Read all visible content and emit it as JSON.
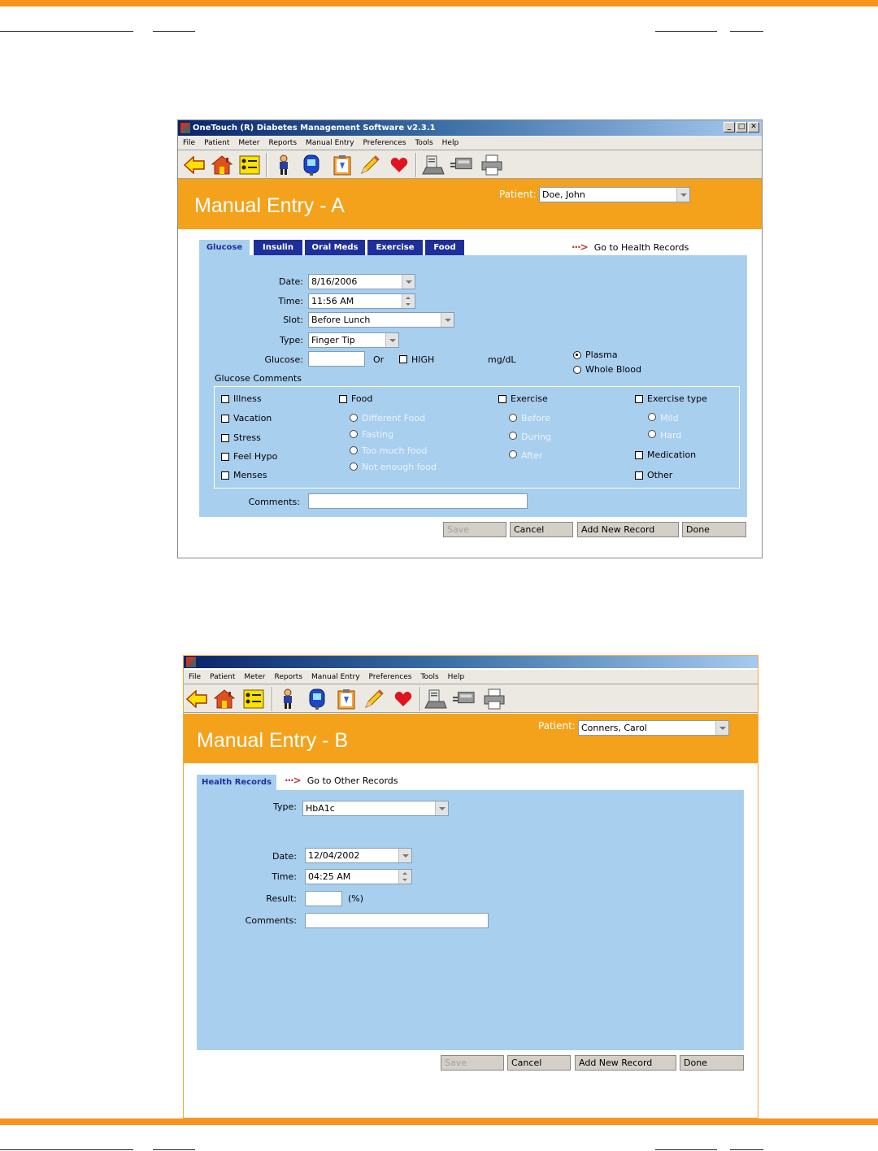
{
  "window_a": {
    "title": "OneTouch (R) Diabetes Management Software v2.3.1",
    "menu": [
      "File",
      "Patient",
      "Meter",
      "Reports",
      "Manual Entry",
      "Preferences",
      "Tools",
      "Help"
    ],
    "header_title": "Manual Entry - A",
    "patient_label": "Patient:",
    "patient_value": "Doe, John",
    "tabs": [
      "Glucose",
      "Insulin",
      "Oral Meds",
      "Exercise",
      "Food"
    ],
    "goto_link": "Go to Health Records",
    "form": {
      "date_label": "Date:",
      "date_value": "8/16/2006",
      "time_label": "Time:",
      "time_value": "11:56 AM",
      "slot_label": "Slot:",
      "slot_value": "Before Lunch",
      "type_label": "Type:",
      "type_value": "Finger Tip",
      "glucose_label": "Glucose:",
      "or_label": "Or",
      "high_label": "HIGH",
      "unit_label": "mg/dL",
      "plasma_label": "Plasma",
      "whole_blood_label": "Whole Blood",
      "comments_section_label": "Glucose Comments",
      "comments_label": "Comments:"
    },
    "glucose_comments": {
      "illness": "Illness",
      "vacation": "Vacation",
      "stress": "Stress",
      "feel_hypo": "Feel Hypo",
      "menses": "Menses",
      "food": "Food",
      "different_food": "Different Food",
      "fasting": "Fasting",
      "too_much_food": "Too much food",
      "not_enough_food": "Not enough food",
      "exercise": "Exercise",
      "before": "Before",
      "during": "During",
      "after": "After",
      "exercise_type": "Exercise type",
      "mild": "Mild",
      "hard": "Hard",
      "medication": "Medication",
      "other": "Other"
    },
    "buttons": {
      "save": "Save",
      "cancel": "Cancel",
      "add_new": "Add New Record",
      "done": "Done"
    }
  },
  "window_b": {
    "menu": [
      "File",
      "Patient",
      "Meter",
      "Reports",
      "Manual Entry",
      "Preferences",
      "Tools",
      "Help"
    ],
    "header_title": "Manual Entry - B",
    "patient_label": "Patient:",
    "patient_value": "Conners, Carol",
    "tab": "Health Records",
    "goto_link": "Go to Other Records",
    "form": {
      "type_label": "Type:",
      "type_value": "HbA1c",
      "date_label": "Date:",
      "date_value": "12/04/2002",
      "time_label": "Time:",
      "time_value": "04:25 AM",
      "result_label": "Result:",
      "result_unit": "(%)",
      "comments_label": "Comments:"
    },
    "buttons": {
      "save": "Save",
      "cancel": "Cancel",
      "add_new": "Add New Record",
      "done": "Done"
    }
  },
  "colors": {
    "accent_orange": "#f4a21c",
    "panel_blue": "#a9cfef",
    "tab_blue": "#1e2f9c"
  }
}
